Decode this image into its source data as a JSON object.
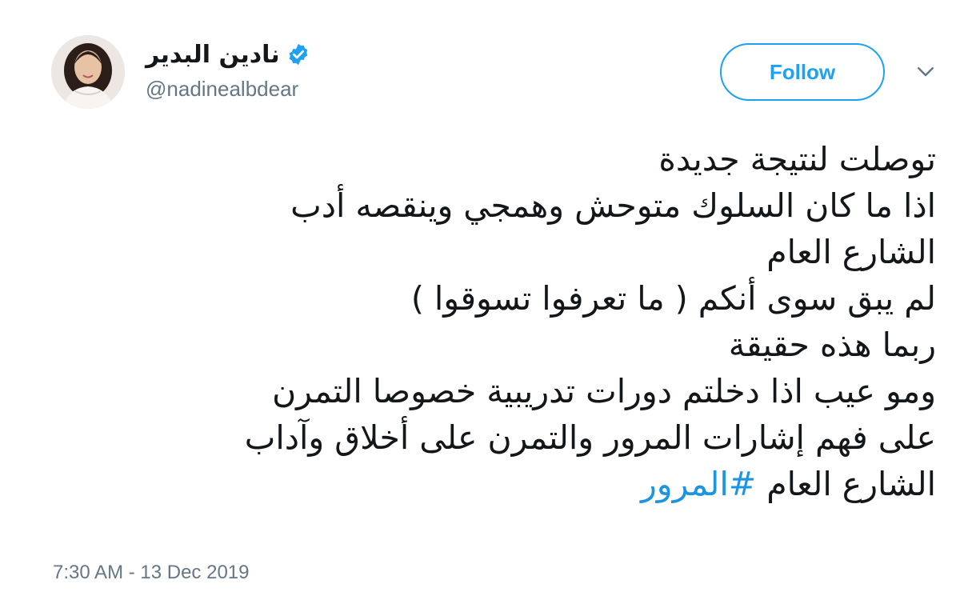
{
  "user": {
    "display_name": "نادين البدير",
    "handle": "@nadinealbdear",
    "verified": true,
    "avatar_icon": "user-avatar-photo"
  },
  "actions": {
    "follow_label": "Follow",
    "menu_icon": "chevron-down-icon"
  },
  "tweet": {
    "lines": [
      "توصلت لنتيجة جديدة",
      "اذا ما كان السلوك متوحش وهمجي وينقصه أدب",
      "الشارع العام",
      "لم يبق سوى أنكم ( ما تعرفوا تسوقوا )",
      "ربما هذه حقيقة",
      "ومو عيب اذا دخلتم دورات تدريبية خصوصا التمرن",
      "على فهم إشارات المرور والتمرن على أخلاق وآداب"
    ],
    "last_line_text": "الشارع العام",
    "hashtag": "#المرور"
  },
  "timestamp": "7:30 AM - 13 Dec 2019",
  "colors": {
    "accent": "#1da1f2",
    "link": "#1b95e0",
    "text": "#14171a",
    "secondary": "#657786"
  }
}
